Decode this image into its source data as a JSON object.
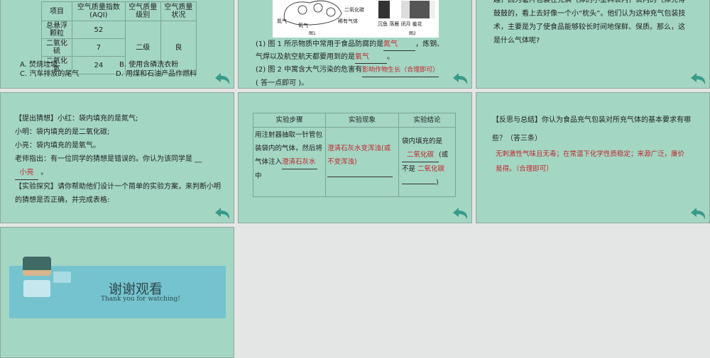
{
  "slide1": {
    "headers": [
      "项目",
      "空气质量指数 (AQI)",
      "空气质量级别",
      "空气质量状况"
    ],
    "rows": [
      [
        "总悬浮颗粒",
        "52"
      ],
      [
        "二氧化硫",
        "7"
      ],
      [
        "二氧化氮",
        "24"
      ]
    ],
    "level": "二级",
    "status": "良",
    "options": [
      "A. 焚烧垃圾",
      "B. 使用含磷洗衣粉",
      "C. 汽车排放的尾气",
      "D. 用煤和石油产品作燃料"
    ]
  },
  "slide2": {
    "fig1_labels": [
      "二氧化碳",
      "氮气",
      "氧气",
      "稀有气体"
    ],
    "fig1_caption": "图1",
    "fig2_labels": "沉鱼 落雁 闭月 羞花",
    "fig2_caption": "图2",
    "q1a": "(1) 图 1 所示物质中常用于食品防腐的是",
    "a1": "氮气",
    "q1b": "，炼钢、",
    "q1c": "气焊以及航空航天都要用到的是",
    "a2": "氧气",
    "q1d": "。",
    "q2a": "(2) 图 2 中寓含大气污染的危害有",
    "a3": "影响作物生长（合理即可）",
    "q2b": "( 答一点即可 )。"
  },
  "slide3": {
    "text": "趣，因为薯片包装在充满气体的小塑料袋内，袋内的气体充得鼓鼓的，看上去好像一个小“枕头”。他们认为这种充气包装技术，主要是为了使食品能够较长时间地保鲜、保质。那么，这是什么气体呢?"
  },
  "slide4": {
    "l1": "【提出猜想】小红：袋内填充的是氮气;",
    "l2": "小明：袋内填充的是二氧化碳;",
    "l3": "小亮：袋内填充的是氧气。",
    "l4": "老师指出：有一位同学的猜想是错误的。你认为该同学是 __",
    "a": "小亮",
    "l5end": "。",
    "l6": "【实验探究】请你帮助他们设计一个简单的实验方案，来判断小明的猜想是否正确，并完成表格:"
  },
  "slide5": {
    "headers": [
      "实验步骤",
      "实验现象",
      "实验结论"
    ],
    "step": "用注射器抽取一针管包装袋内的气体，然后将气体注入",
    "step_a": "澄清石灰水",
    "step_end": "中",
    "phen": "澄清石灰水变浑浊(或不变浑浊)",
    "c1": "袋内填充的是",
    "c_a1": "二氧化碳",
    "c2": "(或不是",
    "c_a2": "二氧化碳",
    "c3": ")"
  },
  "slide6": {
    "q": "【反思与总结】你认为食品充气包装对所充气体的基本要求有哪些？（答三条）",
    "a": "无刺激性气味且无毒；在常温下化学性质稳定；来源广泛，廉价易得。（合理即可）"
  },
  "slide7": {
    "title": "谢谢观看",
    "subtitle": "Thank you for watching!"
  }
}
